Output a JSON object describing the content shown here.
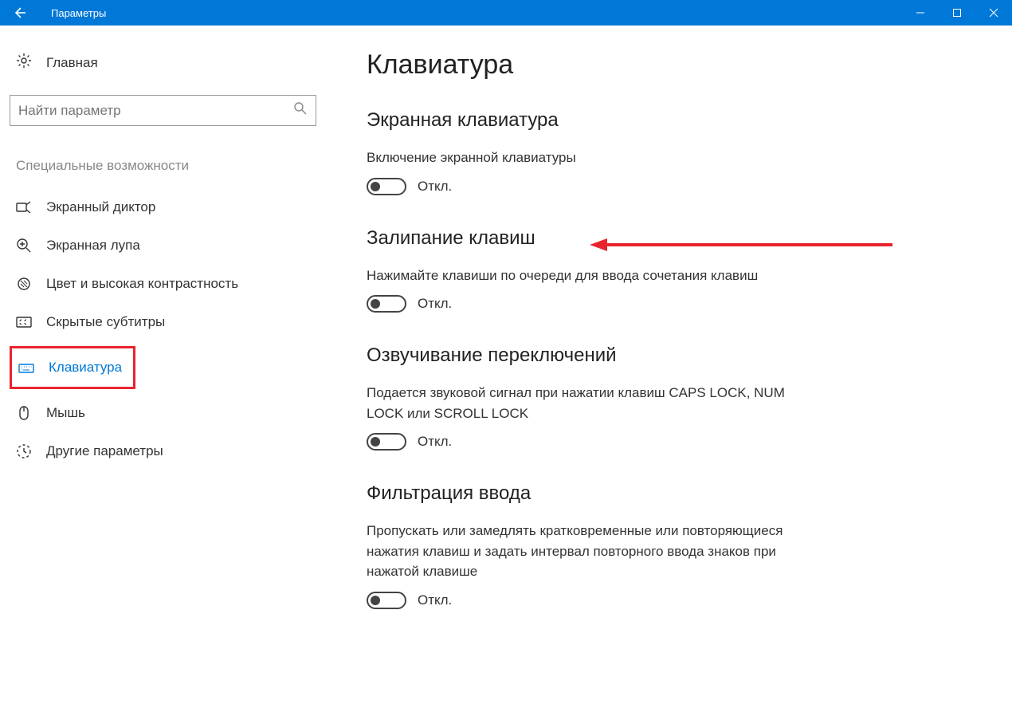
{
  "titlebar": {
    "title": "Параметры"
  },
  "sidebar": {
    "home_label": "Главная",
    "search_placeholder": "Найти параметр",
    "section_label": "Специальные возможности",
    "items": [
      {
        "label": "Экранный диктор",
        "icon": "narrator-icon"
      },
      {
        "label": "Экранная лупа",
        "icon": "magnifier-icon"
      },
      {
        "label": "Цвет и высокая контрастность",
        "icon": "contrast-icon"
      },
      {
        "label": "Скрытые субтитры",
        "icon": "captions-icon"
      },
      {
        "label": "Клавиатура",
        "icon": "keyboard-icon",
        "active": true
      },
      {
        "label": "Мышь",
        "icon": "mouse-icon"
      },
      {
        "label": "Другие параметры",
        "icon": "other-icon"
      }
    ]
  },
  "main": {
    "page_title": "Клавиатура",
    "sections": [
      {
        "heading": "Экранная клавиатура",
        "desc": "Включение экранной клавиатуры",
        "toggle_state": "Откл."
      },
      {
        "heading": "Залипание клавиш",
        "desc": "Нажимайте клавиши по очереди для ввода сочетания клавиш",
        "toggle_state": "Откл."
      },
      {
        "heading": "Озвучивание переключений",
        "desc": "Подается звуковой сигнал при нажатии клавиш CAPS LOCK, NUM LOCK или SCROLL LOCK",
        "toggle_state": "Откл."
      },
      {
        "heading": "Фильтрация ввода",
        "desc": "Пропускать или замедлять кратковременные или повторяющиеся нажатия клавиш и задать интервал повторного ввода знаков при нажатой клавише",
        "toggle_state": "Откл."
      }
    ]
  }
}
